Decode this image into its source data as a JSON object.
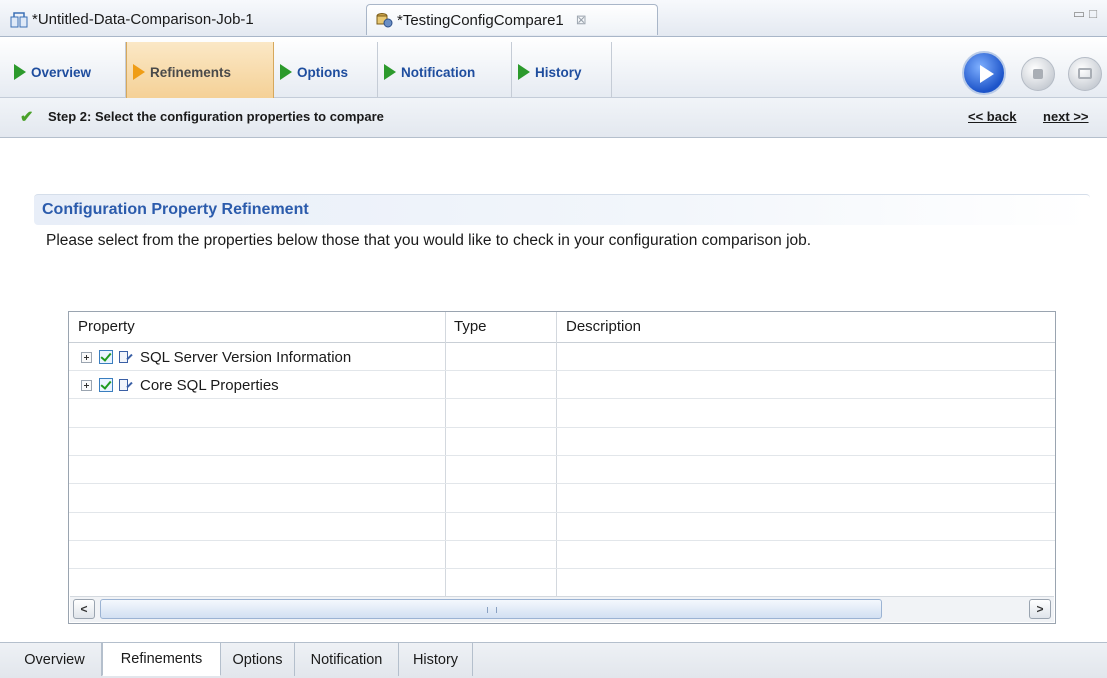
{
  "editor_tabs": [
    {
      "label": "*Untitled-Data-Comparison-Job-1",
      "icon": "data-comparison-icon",
      "active": false
    },
    {
      "label": "*TestingConfigCompare1",
      "icon": "config-compare-icon",
      "active": true,
      "close": "⊠"
    }
  ],
  "step_tabs": [
    {
      "label": "Overview",
      "icon": "play-arrow-icon",
      "active": false
    },
    {
      "label": "Refinements",
      "icon": "play-arrow-icon",
      "active": true
    },
    {
      "label": "Options",
      "icon": "play-arrow-icon",
      "active": false
    },
    {
      "label": "Notification",
      "icon": "play-arrow-icon",
      "active": false
    },
    {
      "label": "History",
      "icon": "play-arrow-icon",
      "active": false
    }
  ],
  "toolbar_buttons": [
    "run-icon",
    "stop-icon",
    "log-icon"
  ],
  "step": {
    "text": "Step 2: Select the configuration properties to compare",
    "back": "<< back",
    "next": "next >>"
  },
  "section": {
    "title": "Configuration Property Refinement",
    "description": "Please select from the properties below those that you would like to check in your configuration comparison job."
  },
  "table": {
    "columns": [
      "Property",
      "Type",
      "Description"
    ],
    "rows": [
      {
        "property": "SQL Server Version Information",
        "type": "",
        "description": "",
        "checked": true,
        "expandable": true
      },
      {
        "property": "Core SQL Properties",
        "type": "",
        "description": "",
        "checked": true,
        "expandable": true
      }
    ]
  },
  "bottom_tabs": [
    {
      "label": "Overview",
      "active": false
    },
    {
      "label": "Refinements",
      "active": true
    },
    {
      "label": "Options",
      "active": false
    },
    {
      "label": "Notification",
      "active": false
    },
    {
      "label": "History",
      "active": false
    }
  ],
  "colors": {
    "link_blue": "#1e4d9e",
    "section_title": "#2b5bac",
    "active_tab": "#f4cf93",
    "play_green": "#2c9a2c",
    "check_green": "#4aa12a"
  }
}
